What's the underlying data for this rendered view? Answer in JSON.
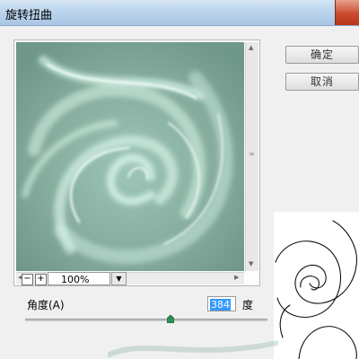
{
  "window": {
    "title": "旋转扭曲"
  },
  "buttons": {
    "ok": "确定",
    "cancel": "取消"
  },
  "zoom": {
    "minus": "−",
    "plus": "+",
    "value": "100%"
  },
  "angle": {
    "label": "角度(A)",
    "value": "384",
    "unit": "度",
    "slider_position_fraction": 0.6
  },
  "colors": {
    "preview_bg": "#7fa596",
    "swirl_highlight": "#d8f6ea",
    "selection": "#3399ff"
  },
  "icons": [
    "close-icon",
    "zoom-out-icon",
    "zoom-in-icon",
    "dropdown-arrow-icon",
    "slider-thumb-icon"
  ]
}
